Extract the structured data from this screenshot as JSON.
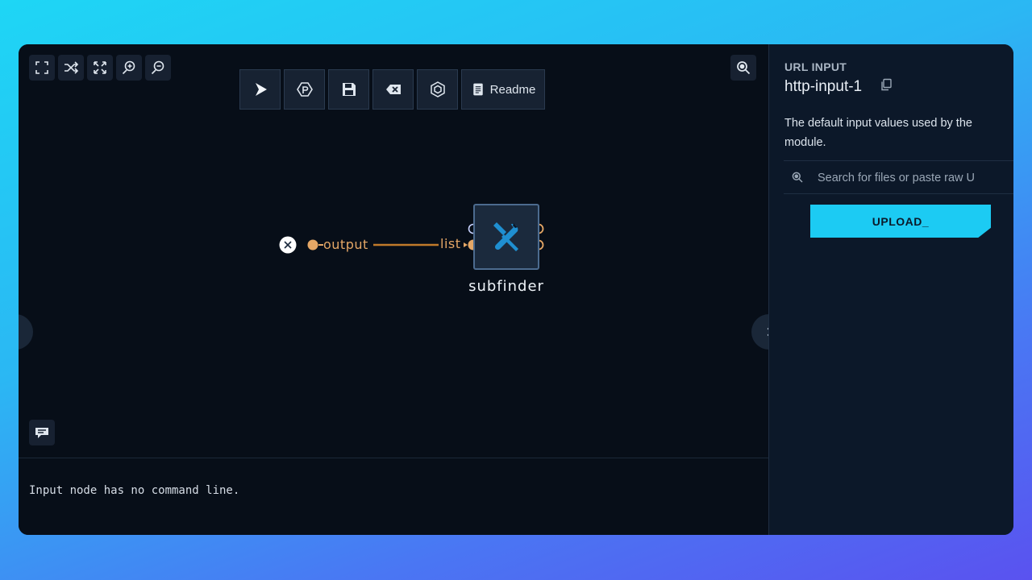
{
  "toolbar": {
    "readme_label": "Readme"
  },
  "graph": {
    "edge_from_label": "output",
    "edge_to_label": "list",
    "node_title": "subfinder"
  },
  "console": {
    "message": "Input node has no command line."
  },
  "panel": {
    "heading": "URL INPUT",
    "title": "http-input-1",
    "description": "The default input values used by the module.",
    "search_placeholder": "Search for files or paste raw U",
    "upload_label": "UPLOAD_"
  },
  "colors": {
    "accent": "#1ccbf3",
    "edge": "#e5a766",
    "background": "#070e18"
  }
}
